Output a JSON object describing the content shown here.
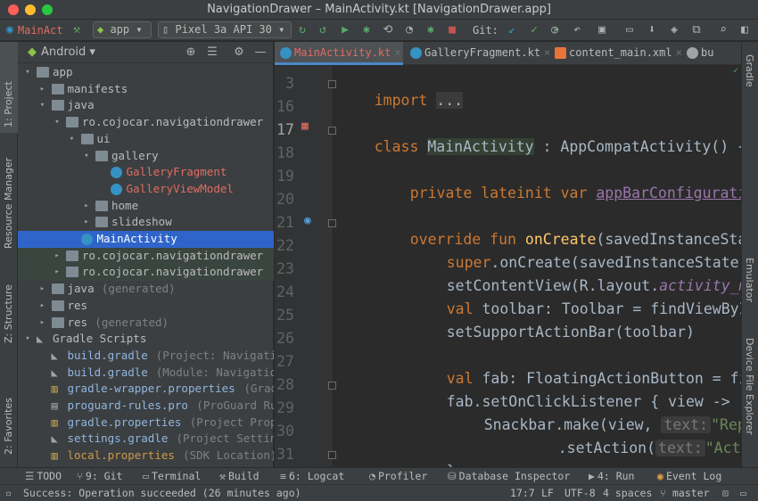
{
  "window": {
    "title": "NavigationDrawer – MainActivity.kt [NavigationDrawer.app]"
  },
  "toolbar": {
    "breadcrumb": "MainAct",
    "module": "app",
    "device": "Pixel 3a API 30",
    "git_label": "Git:"
  },
  "left_tabs": {
    "project": "1: Project",
    "resource_manager": "Resource Manager",
    "structure": "Z: Structure",
    "favorites": "2: Favorites"
  },
  "right_tabs": {
    "gradle": "Gradle",
    "emulator": "Emulator",
    "device_explorer": "Device File Explorer"
  },
  "project_panel": {
    "view": "Android",
    "tree": [
      {
        "label": "app",
        "extra": "",
        "depth": 0
      },
      {
        "label": "manifests",
        "extra": "",
        "depth": 1
      },
      {
        "label": "java",
        "extra": "",
        "depth": 1
      },
      {
        "label": "ro.cojocar.navigationdrawer",
        "extra": "",
        "depth": 2
      },
      {
        "label": "ui",
        "extra": "",
        "depth": 3
      },
      {
        "label": "gallery",
        "extra": "",
        "depth": 4
      },
      {
        "label": "GalleryFragment",
        "extra": "",
        "depth": 5
      },
      {
        "label": "GalleryViewModel",
        "extra": "",
        "depth": 5
      },
      {
        "label": "home",
        "extra": "",
        "depth": 4
      },
      {
        "label": "slideshow",
        "extra": "",
        "depth": 4
      },
      {
        "label": "MainActivity",
        "extra": "",
        "depth": 3
      },
      {
        "label": "ro.cojocar.navigationdrawer",
        "extra": "(",
        "depth": 2
      },
      {
        "label": "ro.cojocar.navigationdrawer",
        "extra": "(",
        "depth": 2
      },
      {
        "label": "java",
        "extra": "(generated)",
        "depth": 1
      },
      {
        "label": "res",
        "extra": "",
        "depth": 1
      },
      {
        "label": "res",
        "extra": "(generated)",
        "depth": 1
      },
      {
        "label": "Gradle Scripts",
        "extra": "",
        "depth": 0
      },
      {
        "label": "build.gradle",
        "extra": "(Project: Navigatio",
        "depth": 1
      },
      {
        "label": "build.gradle",
        "extra": "(Module: Navigatio",
        "depth": 1
      },
      {
        "label": "gradle-wrapper.properties",
        "extra": "(Grad",
        "depth": 1
      },
      {
        "label": "proguard-rules.pro",
        "extra": "(ProGuard Ru",
        "depth": 1
      },
      {
        "label": "gradle.properties",
        "extra": "(Project Prope",
        "depth": 1
      },
      {
        "label": "settings.gradle",
        "extra": "(Project Setting",
        "depth": 1
      },
      {
        "label": "local.properties",
        "extra": "(SDK Location)",
        "depth": 1
      }
    ]
  },
  "editor_tabs": [
    {
      "label": "MainActivity.kt",
      "active": true
    },
    {
      "label": "GalleryFragment.kt",
      "active": false
    },
    {
      "label": "content_main.xml",
      "active": false
    },
    {
      "label": "bu",
      "active": false
    }
  ],
  "editor": {
    "line_numbers": [
      "3",
      "16",
      "17",
      "18",
      "19",
      "20",
      "21",
      "22",
      "23",
      "24",
      "25",
      "26",
      "27",
      "28",
      "29",
      "30",
      "31"
    ],
    "lines": {
      "l3_kw": "import",
      "l3_rest": "...",
      "l17_kw": "class",
      "l17_name": "MainActivity",
      "l17_rest": ": AppCompatActivity() {",
      "l19_kw": "private lateinit var",
      "l19_prop": "appBarConfiguration",
      "l21_kw": "override fun",
      "l21_fn": "onCreate",
      "l21_rest": "(savedInstanceState",
      "l22_kw": "super",
      "l22_rest": ".onCreate(savedInstanceState)",
      "l23_a": "setContentView(R.layout.",
      "l23_b": "activity_mai",
      "l24_kw": "val",
      "l24_rest": "toolbar: Toolbar = findViewById(",
      "l25": "setSupportActionBar(toolbar)",
      "l27_kw": "val",
      "l27_rest": "fab: FloatingActionButton = find",
      "l28_a": "fab.setOnClickListener {",
      "l28_b": "view ->",
      "l29_a": "Snackbar.make(view,",
      "l29_hint": "text:",
      "l29_str": "\"Repla",
      "l30_a": ".setAction(",
      "l30_hint": "text:",
      "l30_str": "\"Action",
      "l31": "}"
    }
  },
  "bottom_tools": [
    "TODO",
    "9: Git",
    "Terminal",
    "Build",
    "6: Logcat",
    "Profiler",
    "Database Inspector",
    "4: Run",
    "Event Log"
  ],
  "status": {
    "message": "Success: Operation succeeded (26 minutes ago)",
    "position": "17:7",
    "line_sep": "LF",
    "encoding": "UTF-8",
    "indent": "4 spaces",
    "branch": "master"
  }
}
